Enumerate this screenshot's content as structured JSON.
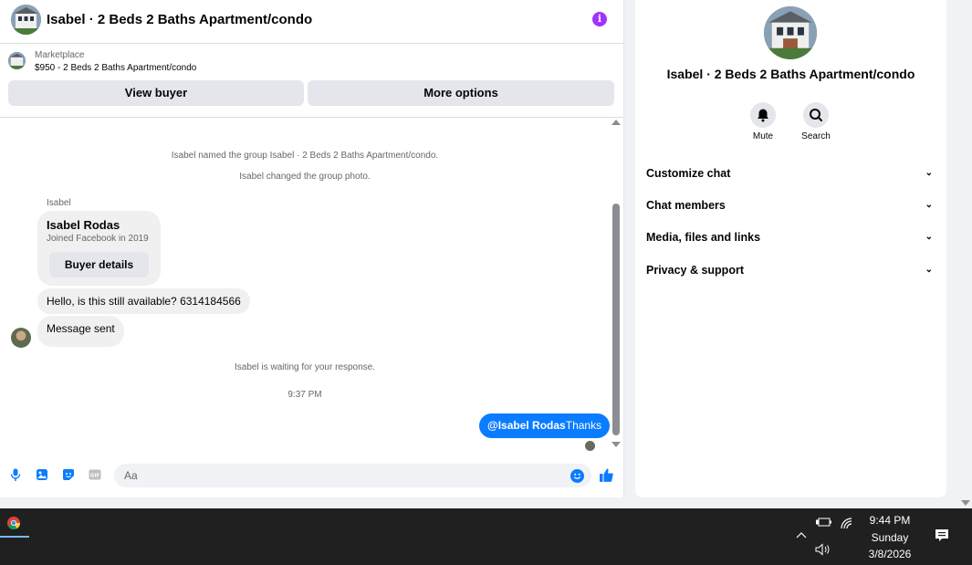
{
  "chat": {
    "title": "Isabel · 2 Beds 2 Baths Apartment/condo",
    "info_icon": "info-icon",
    "listing": {
      "source": "Marketplace",
      "price_title": "$950 - 2 Beds 2 Baths Apartment/condo"
    },
    "buttons": {
      "view_buyer": "View buyer",
      "more_options": "More options"
    },
    "system_messages": [
      "Isabel named the group Isabel · 2 Beds 2 Baths Apartment/condo.",
      "Isabel changed the group photo."
    ],
    "sender_label": "Isabel",
    "buyer_card": {
      "name": "Isabel Rodas",
      "joined": "Joined Facebook in 2019",
      "details_button": "Buyer details"
    },
    "incoming": [
      "Hello, is this still available? 6314184566",
      "Message sent"
    ],
    "waiting_notice": "Isabel is waiting for your response.",
    "timestamp": "9:37 PM",
    "outgoing": {
      "mention": "@Isabel Rodas",
      "text": "Thanks"
    },
    "composer": {
      "placeholder": "Aa"
    },
    "accent_color": "#0a7cff"
  },
  "details": {
    "title": "Isabel · 2 Beds 2 Baths Apartment/condo",
    "actions": [
      {
        "label": "Mute",
        "icon": "bell-icon"
      },
      {
        "label": "Search",
        "icon": "search-icon"
      }
    ],
    "sections": [
      "Customize chat",
      "Chat members",
      "Media, files and links",
      "Privacy & support"
    ]
  },
  "taskbar": {
    "time": "9:44 PM",
    "day": "Sunday",
    "date": "3/8/2026"
  }
}
